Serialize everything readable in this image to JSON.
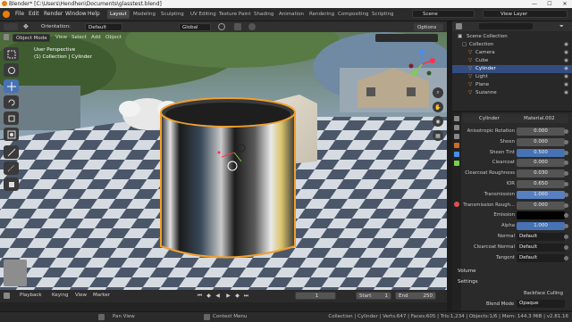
{
  "window": {
    "title": "Blender* [C:\\Users\\Hendhen\\Documents\\glasstest.blend]",
    "minimize": "—",
    "maximize": "☐",
    "close": "✕"
  },
  "menus": [
    "File",
    "Edit",
    "Render",
    "Window",
    "Help"
  ],
  "workspaces": [
    "Layout",
    "Modeling",
    "Sculpting",
    "UV Editing",
    "Texture Paint",
    "Shading",
    "Animation",
    "Rendering",
    "Compositing",
    "Scripting"
  ],
  "active_workspace": "Layout",
  "scene": {
    "label": "Scene",
    "view_layer": "View Layer"
  },
  "tool_options": {
    "orientation_label": "Orientation:",
    "orientation_value": "Default",
    "global": "Global",
    "options": "Options"
  },
  "viewport_header": {
    "mode": "Object Mode",
    "items": [
      "View",
      "Select",
      "Add",
      "Object"
    ]
  },
  "viewport_info": {
    "line1": "User Perspective",
    "line2": "(1) Collection | Cylinder"
  },
  "outliner": {
    "root": "Scene Collection",
    "items": [
      {
        "name": "Collection",
        "indent": 1,
        "selected": false
      },
      {
        "name": "Camera",
        "indent": 2,
        "selected": false
      },
      {
        "name": "Cube",
        "indent": 2,
        "selected": false
      },
      {
        "name": "Cylinder",
        "indent": 2,
        "selected": true
      },
      {
        "name": "Light",
        "indent": 2,
        "selected": false
      },
      {
        "name": "Plane",
        "indent": 2,
        "selected": false
      },
      {
        "name": "Suzanne",
        "indent": 2,
        "selected": false
      }
    ]
  },
  "properties": {
    "object_name": "Cylinder",
    "material_name": "Material.002",
    "rows": [
      {
        "label": "Anisotropic Rotation",
        "value": "0.000",
        "style": "normal"
      },
      {
        "label": "Sheen",
        "value": "0.000",
        "style": "normal"
      },
      {
        "label": "Sheen Tint",
        "value": "0.500",
        "style": "blue"
      },
      {
        "label": "Clearcoat",
        "value": "0.000",
        "style": "normal"
      },
      {
        "label": "Clearcoat Roughness",
        "value": "0.030",
        "style": "normal"
      },
      {
        "label": "IOR",
        "value": "0.650",
        "style": "normal"
      },
      {
        "label": "Transmission",
        "value": "1.000",
        "style": "sel"
      },
      {
        "label": "Transmission Rough...",
        "value": "0.000",
        "style": "normal"
      },
      {
        "label": "Emission",
        "value": "",
        "style": "black"
      },
      {
        "label": "Alpha",
        "value": "1.000",
        "style": "blue"
      },
      {
        "label": "Normal",
        "value": "Default",
        "style": "dark"
      },
      {
        "label": "Clearcoat Normal",
        "value": "Default",
        "style": "dark"
      },
      {
        "label": "Tangent",
        "value": "Default",
        "style": "dark"
      }
    ],
    "sections": [
      "Volume",
      "Settings"
    ],
    "backface_culling": "Backface Culling",
    "blend_mode_label": "Blend Mode",
    "blend_mode_value": "Opaque"
  },
  "timeline": {
    "playback": "Playback",
    "keying": "Keying",
    "view": "View",
    "marker": "Marker",
    "current_frame": "1",
    "start_label": "Start",
    "start_value": "1",
    "end_label": "End",
    "end_value": "250"
  },
  "statusbar": {
    "pan": "Pan View",
    "context": "Context Menu",
    "stats": "Collection | Cylinder | Verts:647 | Faces:605 | Tris:1,234 | Objects:1/6 | Mem: 144.3 MiB | v2.81.16"
  },
  "colors": {
    "accent": "#4772b3",
    "selection_orange": "#f0a030",
    "sky": "#9fb6cf",
    "checker_light": "#d9dde3",
    "checker_dark": "#4a5668"
  }
}
